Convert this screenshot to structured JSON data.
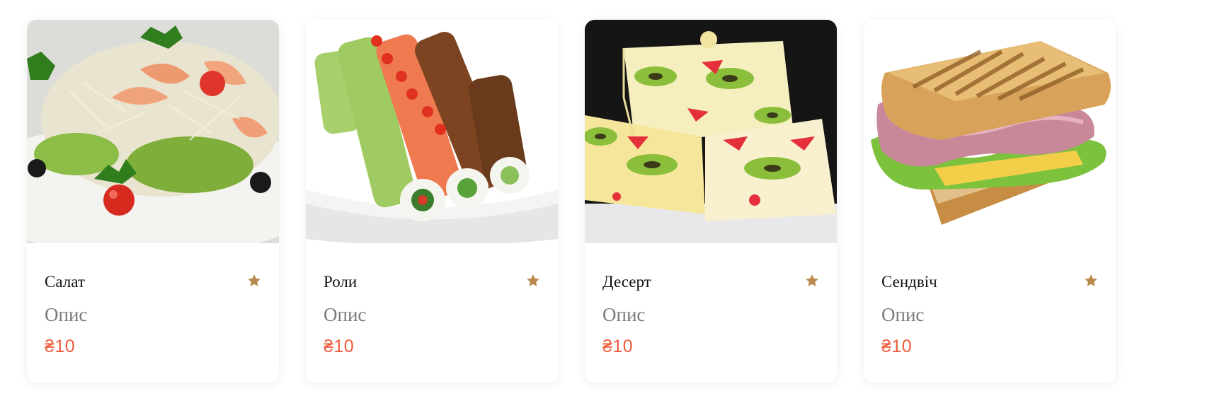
{
  "accent_color": "#b8894a",
  "price_color": "#ef5b3c",
  "products": [
    {
      "name": "Салат",
      "description": "Опис",
      "price": "₴10",
      "image": "caesar-salad-with-shrimp-image",
      "star_icon": "star-icon"
    },
    {
      "name": "Роли",
      "description": "Опис",
      "price": "₴10",
      "image": "sushi-rolls-image",
      "star_icon": "star-icon"
    },
    {
      "name": "Десерт",
      "description": "Опис",
      "price": "₴10",
      "image": "fruit-jelly-dessert-image",
      "star_icon": "star-icon"
    },
    {
      "name": "Сендвіч",
      "description": "Опис",
      "price": "₴10",
      "image": "ham-cheese-sandwich-image",
      "star_icon": "star-icon"
    }
  ]
}
